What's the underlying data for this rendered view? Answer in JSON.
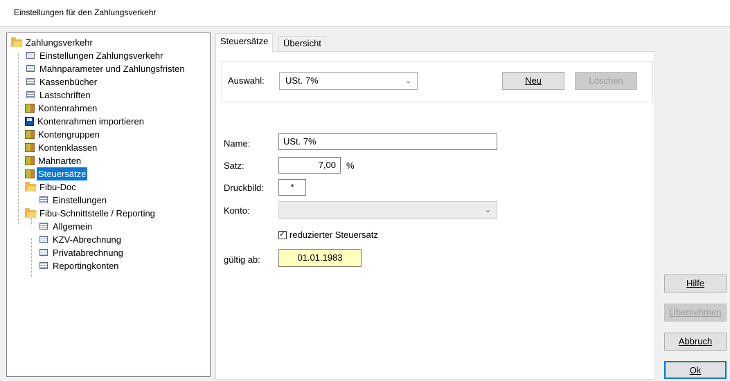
{
  "window": {
    "title": "Einstellungen für den Zahlungsverkehr"
  },
  "tree": {
    "items": [
      {
        "label": "Zahlungsverkehr",
        "icon": "folder-open-icon"
      },
      {
        "label": "Einstellungen Zahlungsverkehr",
        "icon": "list-icon"
      },
      {
        "label": "Mahnparameter und Zahlungsfristen",
        "icon": "list-icon"
      },
      {
        "label": "Kassenbücher",
        "icon": "list-icon"
      },
      {
        "label": "Lastschriften",
        "icon": "list-icon"
      },
      {
        "label": "Kontenrahmen",
        "icon": "books-icon"
      },
      {
        "label": "Kontenrahmen importieren",
        "icon": "disk-icon"
      },
      {
        "label": "Kontengruppen",
        "icon": "books-icon"
      },
      {
        "label": "Kontenklassen",
        "icon": "books-icon"
      },
      {
        "label": "Mahnarten",
        "icon": "books-icon"
      },
      {
        "label": "Steuersätze",
        "icon": "books-icon",
        "selected": true
      },
      {
        "label": "Fibu-Doc",
        "icon": "folder-open-icon"
      },
      {
        "label": "Einstellungen",
        "icon": "list-icon"
      },
      {
        "label": "Fibu-Schnittstelle / Reporting",
        "icon": "folder-open-icon"
      },
      {
        "label": "Allgemein",
        "icon": "list-icon"
      },
      {
        "label": "KZV-Abrechnung",
        "icon": "list-icon"
      },
      {
        "label": "Privatabrechnung",
        "icon": "list-icon"
      },
      {
        "label": "Reportingkonten",
        "icon": "list-icon"
      }
    ]
  },
  "tabs": {
    "active": "Steuersätze",
    "inactive": "Übersicht"
  },
  "form": {
    "auswahl_label": "Auswahl:",
    "auswahl_value": "USt. 7%",
    "neu_button": "Neu",
    "loeschen_button": "Löschen",
    "name_label": "Name:",
    "name_value": "USt. 7%",
    "satz_label": "Satz:",
    "satz_value": "7,00",
    "satz_unit": "%",
    "druckbild_label": "Druckbild:",
    "druckbild_value": "*",
    "konto_label": "Konto:",
    "konto_value": "",
    "reduziert_label": "reduzierter Steuersatz",
    "reduziert_checked": true,
    "gueltig_label": "gültig ab:",
    "gueltig_value": "01.01.1983"
  },
  "buttons": {
    "hilfe": "Hilfe",
    "uebernehmen": "Übernehmen",
    "abbruch": "Abbruch",
    "ok": "Ok"
  },
  "colors": {
    "selection": "#0078d7",
    "date_field": "#ffffc0"
  }
}
